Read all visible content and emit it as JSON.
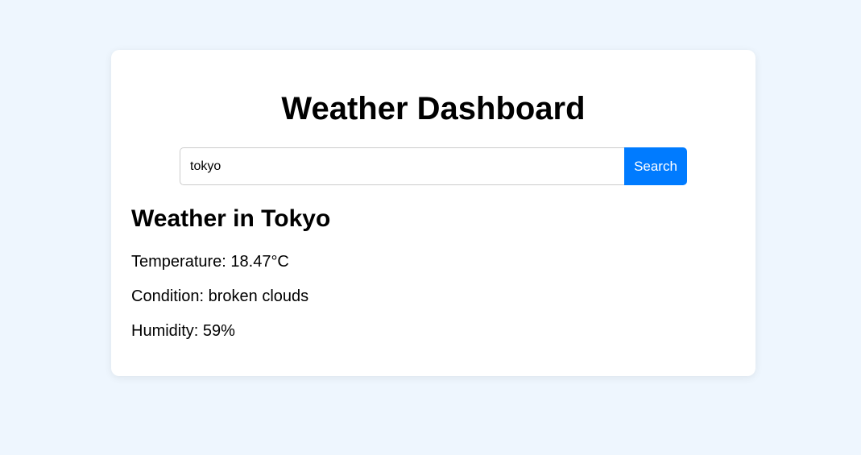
{
  "header": {
    "title": "Weather Dashboard"
  },
  "search": {
    "value": "tokyo",
    "button_label": "Search"
  },
  "result": {
    "heading": "Weather in Tokyo",
    "temperature": "Temperature: 18.47°C",
    "condition": "Condition: broken clouds",
    "humidity": "Humidity: 59%"
  },
  "colors": {
    "page_background": "#eef6fe",
    "card_background": "#ffffff",
    "accent": "#007bff"
  }
}
